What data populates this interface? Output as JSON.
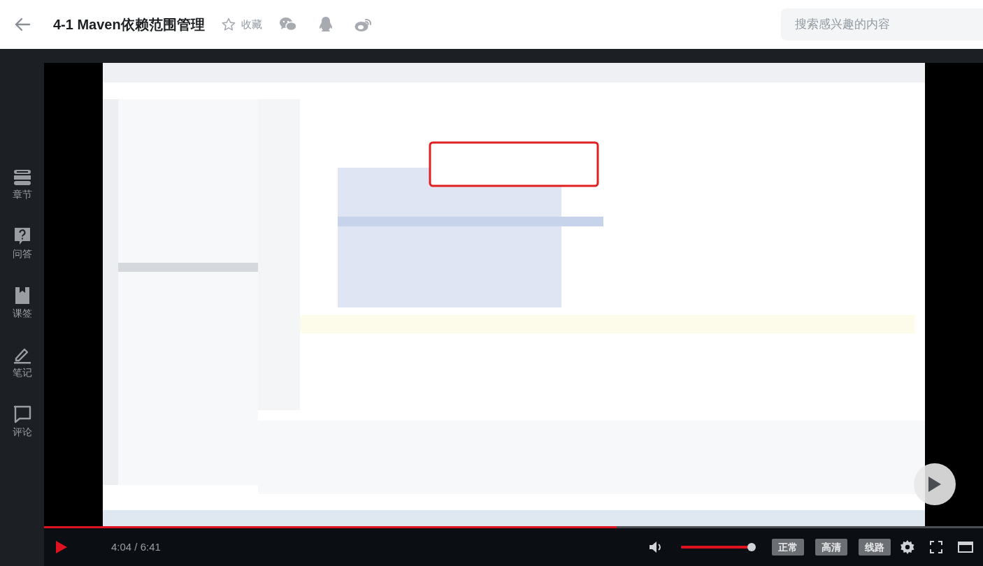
{
  "header": {
    "title": "4-1 Maven依赖范围管理",
    "favorite_label": "收藏",
    "search": {
      "placeholder": "搜索感兴趣的内容"
    }
  },
  "sidebar": {
    "items": [
      {
        "kind": "chapters",
        "label": "章节"
      },
      {
        "kind": "qa",
        "label": "问答"
      },
      {
        "kind": "bookmark",
        "label": "课签"
      },
      {
        "kind": "note",
        "label": "笔记"
      },
      {
        "kind": "comment",
        "label": "评论"
      }
    ]
  },
  "controls": {
    "progress": {
      "level": 0.61
    },
    "time": "4:04 / 6:41",
    "volume": {
      "level": 0.97
    },
    "buttons": [
      "正常",
      "高清",
      "线路"
    ]
  }
}
